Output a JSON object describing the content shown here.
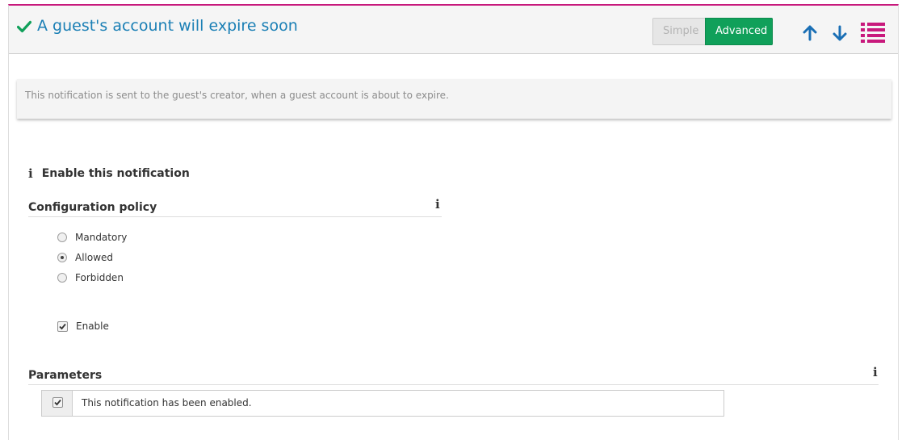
{
  "header": {
    "title": "A guest's account will expire soon",
    "mode_simple": "Simple",
    "mode_advanced": "Advanced"
  },
  "description": "This notification is sent to the guest's creator, when a guest account is about to expire.",
  "enable_heading": "Enable this notification",
  "configuration_policy": {
    "title": "Configuration policy",
    "options": [
      {
        "label": "Mandatory",
        "checked": false
      },
      {
        "label": "Allowed",
        "checked": true
      },
      {
        "label": "Forbidden",
        "checked": false
      }
    ],
    "enable_label": "Enable",
    "enable_checked": true
  },
  "parameters": {
    "title": "Parameters",
    "text": "This notification has been enabled.",
    "checked": true
  },
  "colors": {
    "accent": "#c8197c",
    "title": "#1a7fb5",
    "success": "#10a05a",
    "arrows": "#1a6fb5"
  },
  "icons": {
    "header": "check-icon",
    "move_up": "arrow-up-icon",
    "move_down": "arrow-down-icon",
    "menu": "list-icon",
    "info": "info-icon"
  }
}
